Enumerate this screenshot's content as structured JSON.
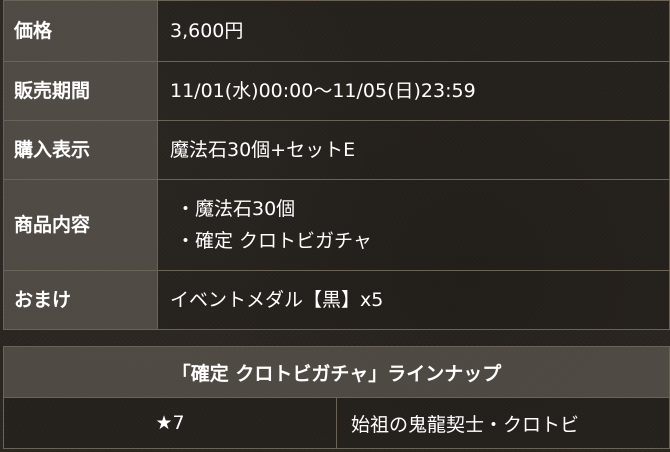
{
  "info": {
    "price": {
      "label": "価格",
      "value": "3,600円"
    },
    "period": {
      "label": "販売期間",
      "value": "11/01(水)00:00〜11/05(日)23:59"
    },
    "display": {
      "label": "購入表示",
      "value": "魔法石30個+セットE"
    },
    "contents": {
      "label": "商品内容",
      "items": [
        "・魔法石30個",
        "・確定 クロトビガチャ"
      ]
    },
    "bonus": {
      "label": "おまけ",
      "value": "イベントメダル【黒】x5"
    }
  },
  "lineup": {
    "title": "「確定 クロトビガチャ」ラインナップ",
    "rows": [
      {
        "rarity": "★7",
        "name": "始祖の鬼龍契士・クロトビ"
      }
    ]
  }
}
